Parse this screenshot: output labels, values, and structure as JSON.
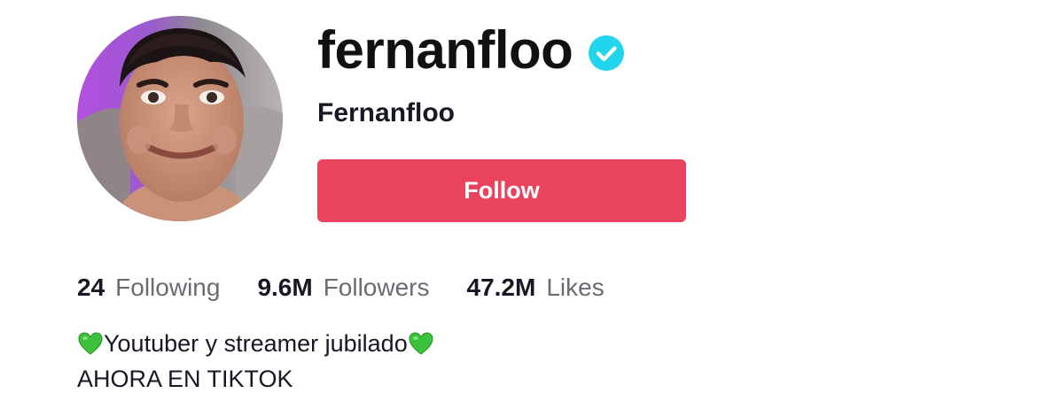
{
  "profile": {
    "username": "fernanfloo",
    "verified": true,
    "nickname": "Fernanfloo",
    "avatar_icon": "profile-photo",
    "verified_icon": "verified-badge-icon",
    "verified_color": "#20D5EC"
  },
  "actions": {
    "follow_label": "Follow",
    "follow_color": "#EA435D"
  },
  "stats": {
    "following": {
      "value": "24",
      "label": "Following"
    },
    "followers": {
      "value": "9.6M",
      "label": "Followers"
    },
    "likes": {
      "value": "47.2M",
      "label": "Likes"
    }
  },
  "bio": {
    "line1_text": "Youtuber y streamer jubilado",
    "line1_emoji_icon": "green-heart-icon",
    "line2_text": "AHORA EN TIKTOK"
  }
}
